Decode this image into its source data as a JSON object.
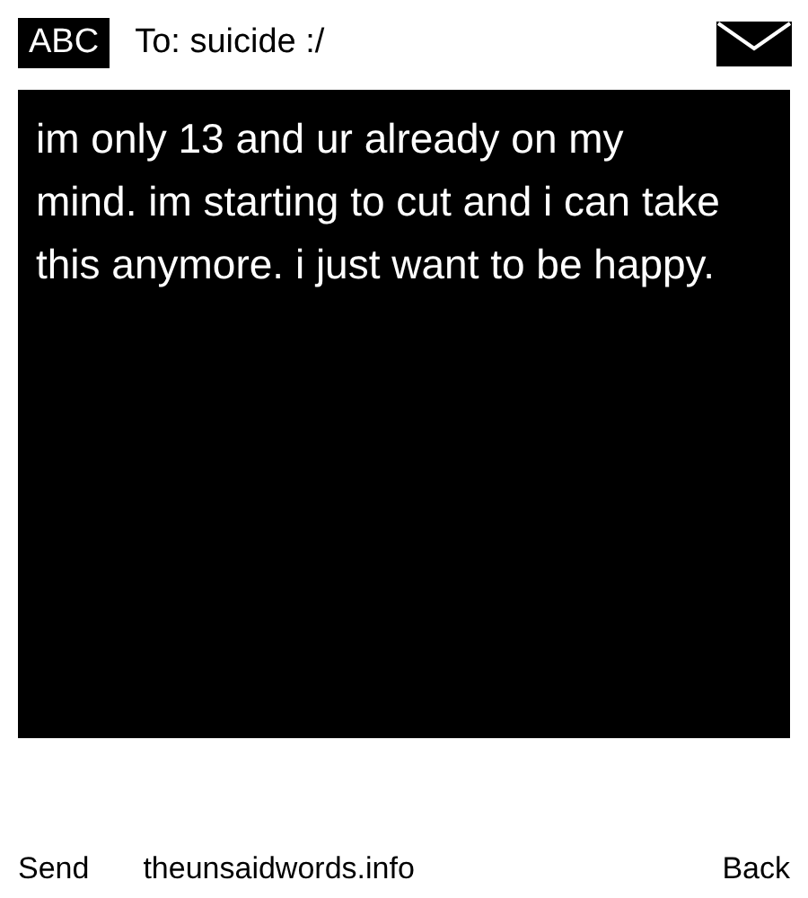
{
  "header": {
    "mode_badge": "ABC",
    "recipient": "To: suicide :/"
  },
  "message": {
    "text": "im only 13 and ur already on my mind. im starting to cut and i can take this anymore. i just want to be happy."
  },
  "softkeys": {
    "left": "Send",
    "center": "theunsaidwords.info",
    "right": "Back"
  }
}
